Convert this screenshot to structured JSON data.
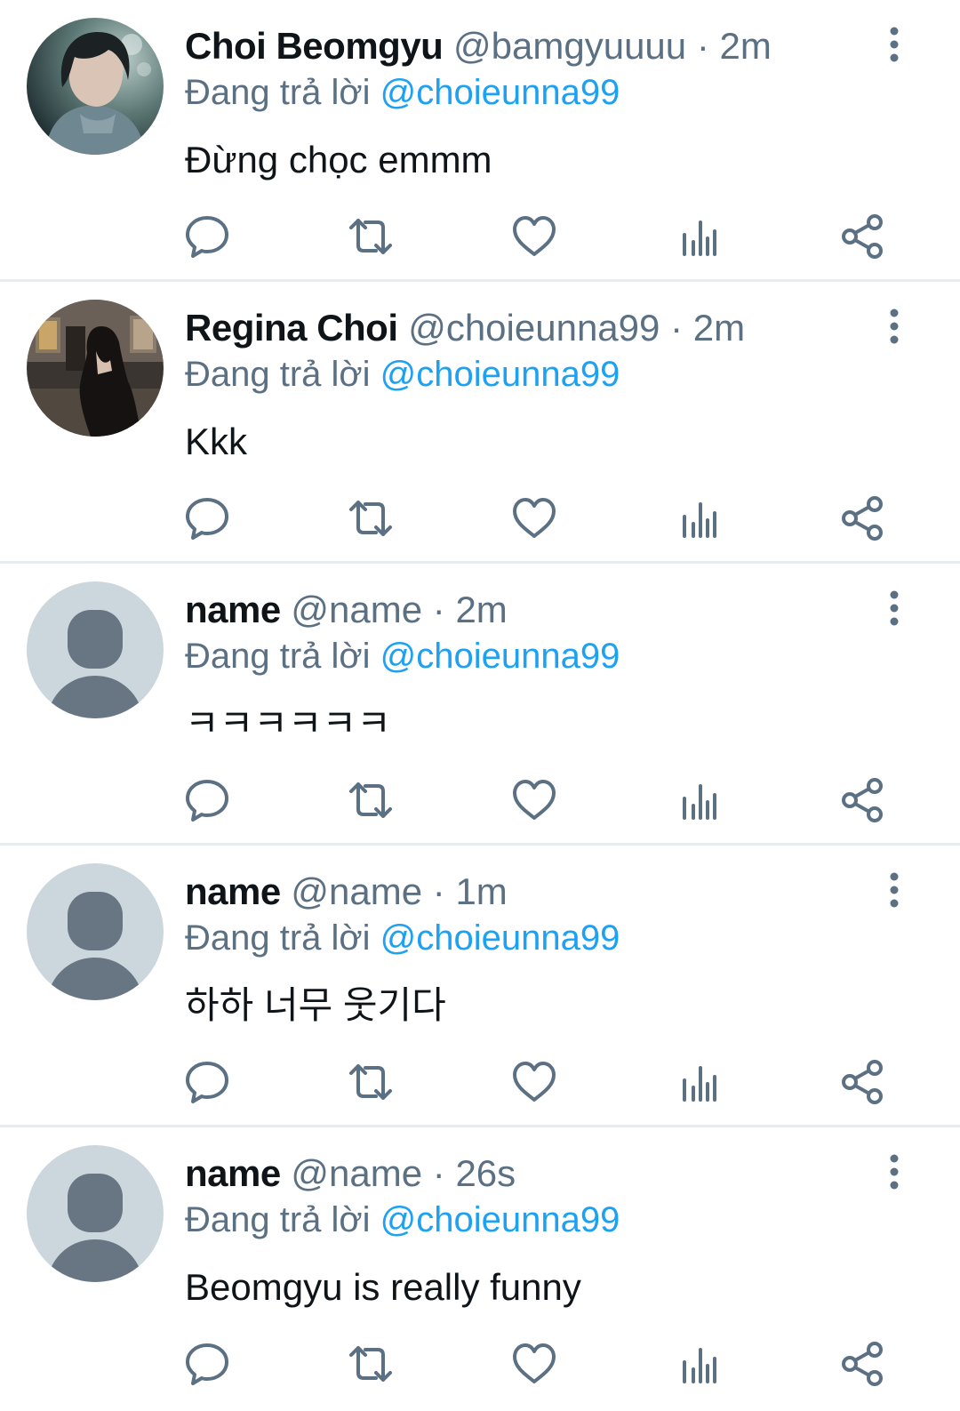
{
  "colors": {
    "primary_text": "#0f1419",
    "secondary_text": "#5b7083",
    "link": "#1da1f2",
    "divider": "#e6ecf0",
    "icon": "#5b7083"
  },
  "action_icons": [
    "reply-icon",
    "retweet-icon",
    "like-icon",
    "analytics-icon",
    "share-icon"
  ],
  "tweets": [
    {
      "display_name": "Choi Beomgyu",
      "handle": "@bamgyuuuu",
      "separator": "·",
      "time": "2m",
      "replying_prefix": "Đang trả lời",
      "replying_to": "@choieunna99",
      "text": "Đừng chọc emmm",
      "avatar": "photo-portrait-man"
    },
    {
      "display_name": "Regina Choi",
      "handle": "@choieunna99",
      "separator": "·",
      "time": "2m",
      "replying_prefix": "Đang trả lời",
      "replying_to": "@choieunna99",
      "text": "Kkk",
      "avatar": "photo-woman-room"
    },
    {
      "display_name": "name",
      "handle": "@name",
      "separator": "·",
      "time": "2m",
      "replying_prefix": "Đang trả lời",
      "replying_to": "@choieunna99",
      "text": "ㅋㅋㅋㅋㅋㅋ",
      "avatar": "default-avatar"
    },
    {
      "display_name": "name",
      "handle": "@name",
      "separator": "·",
      "time": "1m",
      "replying_prefix": "Đang trả lời",
      "replying_to": "@choieunna99",
      "text": "하하 너무 웃기다",
      "avatar": "default-avatar"
    },
    {
      "display_name": "name",
      "handle": "@name",
      "separator": "·",
      "time": "26s",
      "replying_prefix": "Đang trả lời",
      "replying_to": "@choieunna99",
      "text": "Beomgyu is really funny",
      "avatar": "default-avatar"
    }
  ]
}
